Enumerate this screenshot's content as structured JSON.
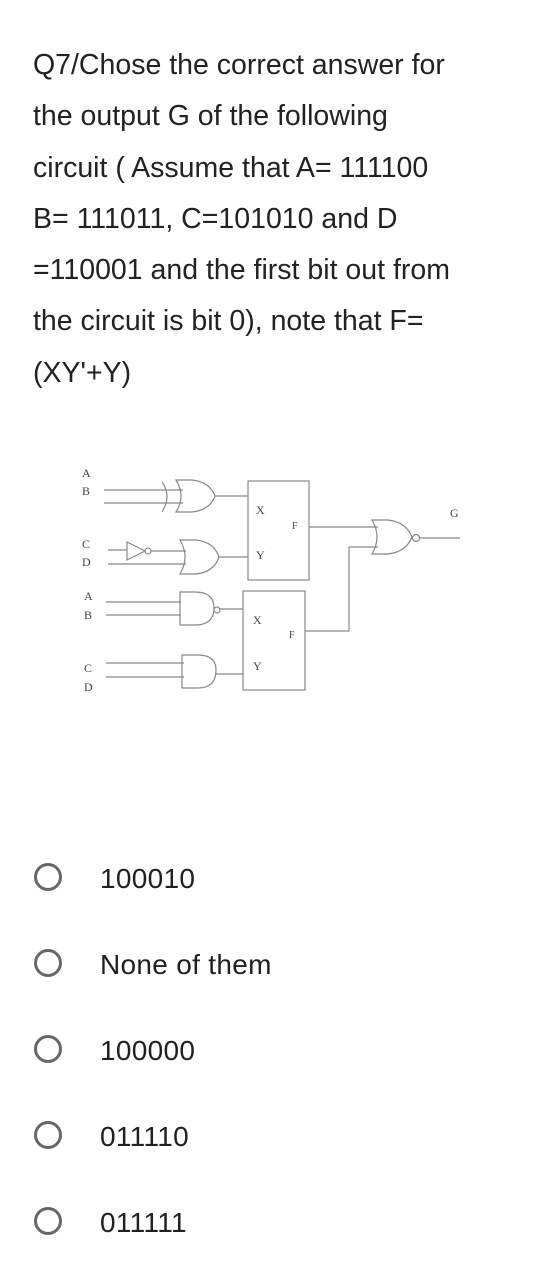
{
  "question": {
    "lines": [
      "Q7/Chose the correct answer for",
      "the output G of the following",
      "circuit  ( Assume that A= 111100",
      "B= 111011, C=101010 and D",
      "=110001 and the first bit out from",
      "the circuit is bit 0), note that F=",
      "(XY'+Y)"
    ]
  },
  "diagram": {
    "labels": {
      "in1_a": "A",
      "in1_b": "B",
      "in2_c": "C",
      "in2_d": "D",
      "in3_a": "A",
      "in3_b": "B",
      "in4_c": "C",
      "in4_d": "D",
      "box1_x": "X",
      "box1_y": "Y",
      "box1_f": "F",
      "box2_x": "X",
      "box2_y": "Y",
      "box2_f": "F",
      "output": "G"
    },
    "gates": [
      "XOR(A,B)",
      "OR(NOT C, D)",
      "NAND(A,B)",
      "AND(C,D)",
      "NOR(F1,F2)"
    ]
  },
  "options": [
    {
      "label": "100010",
      "selected": false
    },
    {
      "label": "None of them",
      "selected": false
    },
    {
      "label": "100000",
      "selected": false
    },
    {
      "label": "011110",
      "selected": false
    },
    {
      "label": "011111",
      "selected": false
    }
  ]
}
